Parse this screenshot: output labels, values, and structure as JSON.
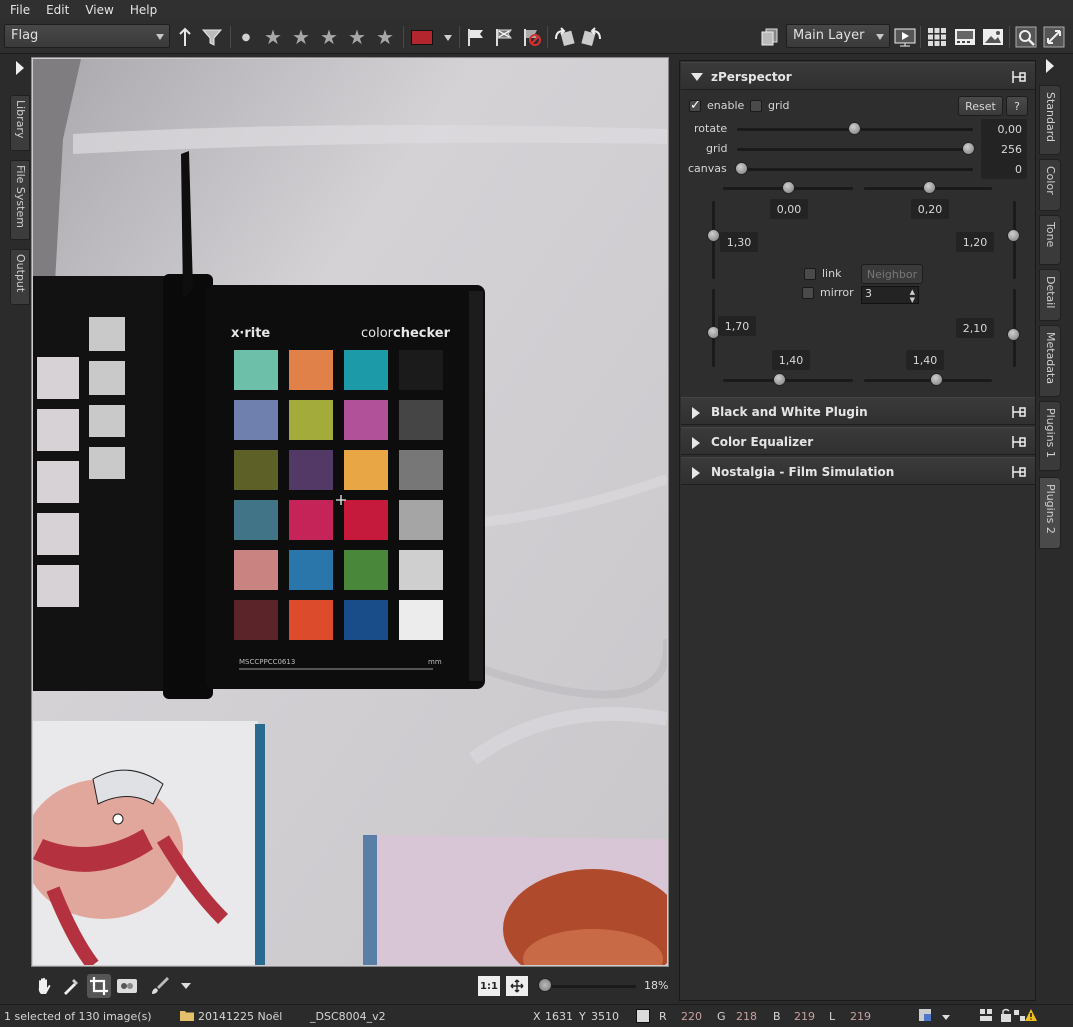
{
  "menu": [
    "File",
    "Edit",
    "View",
    "Help"
  ],
  "toolbar": {
    "filter_combo": "Flag",
    "layer_combo": "Main Layer",
    "color_label": "#b3262e",
    "rating_stars": 5
  },
  "left_tabs": [
    "Library",
    "File System",
    "Output"
  ],
  "right_tabs": [
    "Standard",
    "Color",
    "Tone",
    "Detail",
    "Metadata",
    "Plugins 1",
    "Plugins 2"
  ],
  "right_tabs_active": "Plugins 2",
  "zperspector": {
    "title": "zPerspector",
    "enable_label": "enable",
    "grid_check_label": "grid",
    "reset_label": "Reset",
    "help_label": "?",
    "rotate_label": "rotate",
    "rotate_value": "0,00",
    "grid_label": "grid",
    "grid_value": "256",
    "canvas_label": "canvas",
    "canvas_value": "0",
    "top_left": "0,00",
    "top_right": "0,20",
    "upper_left": "1,30",
    "upper_right": "1,20",
    "link_label": "link",
    "neighbor_label": "Neighbor",
    "mirror_label": "mirror",
    "mirror_value": "3",
    "lower_left": "1,70",
    "lower_right": "2,10",
    "bottom_left": "1,40",
    "bottom_right": "1,40"
  },
  "sections": [
    {
      "title": "Black and White Plugin"
    },
    {
      "title": "Color Equalizer"
    },
    {
      "title": "Nostalgia - Film Simulation"
    }
  ],
  "viewer_bar": {
    "zoom_label": "18%",
    "one_to_one": "1:1"
  },
  "status": {
    "selection": "1 selected of 130 image(s)",
    "folder": "20141225 Noël",
    "filename": "_DSC8004_v2",
    "x_label": "X",
    "x_value": "1631",
    "y_label": "Y",
    "y_value": "3510",
    "r_label": "R",
    "r_value": "220",
    "g_label": "G",
    "g_value": "218",
    "b_label": "B",
    "b_value": "219",
    "l_label": "L",
    "l_value": "219"
  },
  "photo": {
    "brand_left": "x·rite",
    "brand_right_a": "color",
    "brand_right_b": "checker",
    "serial": "MSCCPPCC0613",
    "unit": "mm",
    "swatches": [
      "#6dbfaa",
      "#e1814a",
      "#1d9aa8",
      "#1b1b1b",
      "#6f7fae",
      "#a3ab3a",
      "#b0519a",
      "#454545",
      "#5d6128",
      "#533a66",
      "#e8a644",
      "#777777",
      "#427487",
      "#c42457",
      "#c61a3c",
      "#a5a5a5",
      "#c98481",
      "#2a75aa",
      "#49883a",
      "#cfcfcf",
      "#5a2428",
      "#db4b2c",
      "#194d8a",
      "#ececec"
    ]
  }
}
